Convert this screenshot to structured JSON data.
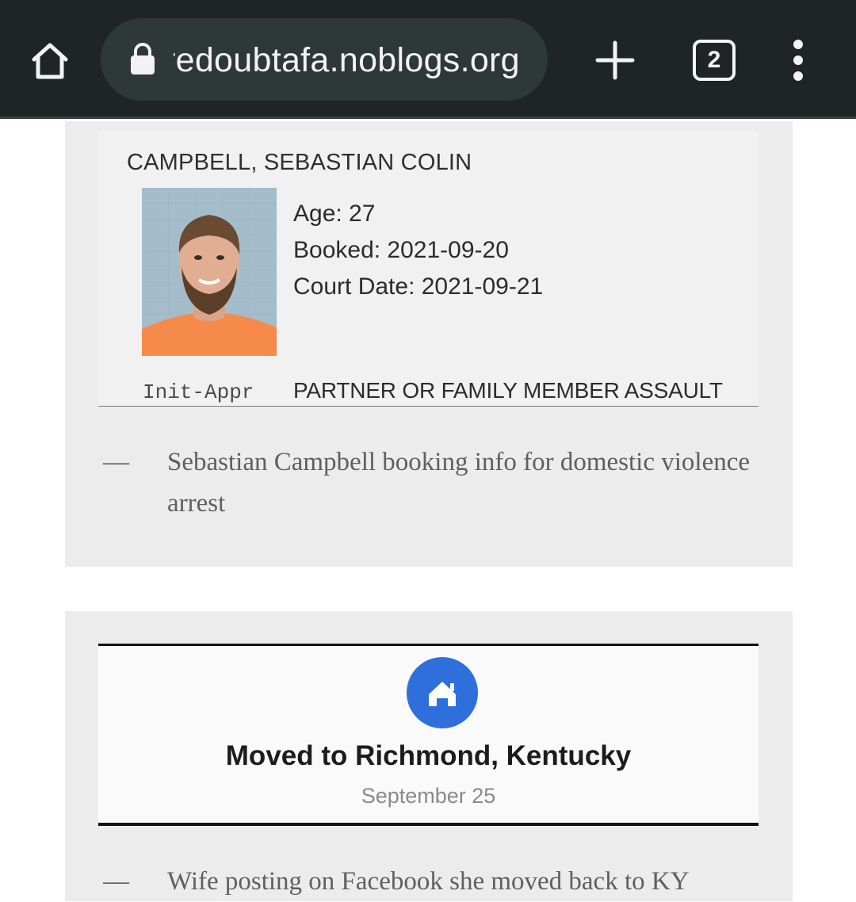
{
  "browser": {
    "url": "redoubtafa.noblogs.org",
    "tab_count": "2",
    "icons": [
      "home-icon",
      "lock-icon",
      "plus-icon",
      "tabs-icon",
      "more-vert-icon"
    ],
    "toolbar_color": "#1f2425",
    "urlbar_color": "#2f3839"
  },
  "post1": {
    "booking": {
      "name": "CAMPBELL, SEBASTIAN COLIN",
      "age": "Age: 27",
      "booked": "Booked: 2021-09-20",
      "court_date": "Court Date: 2021-09-21",
      "init_label": "Init-Appr",
      "charge": "PARTNER OR FAMILY MEMBER ASSAULT"
    },
    "caption_dash": "—",
    "caption": "Sebastian Campbell booking info for domestic violence arrest"
  },
  "post2": {
    "facebook": {
      "title": "Moved to Richmond, Kentucky",
      "date": "September 25",
      "icon": "house-icon",
      "icon_color": "#2f6fdc"
    },
    "caption_dash": "—",
    "caption": "Wife posting on Facebook she moved back to KY"
  }
}
